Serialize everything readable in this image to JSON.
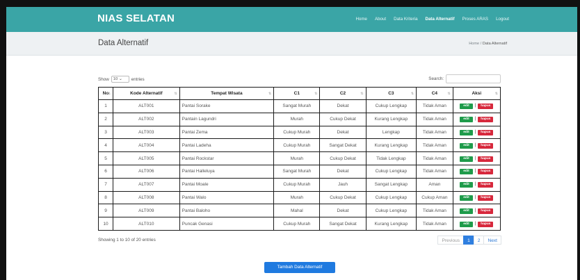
{
  "navbar": {
    "brand": "NIAS SELATAN",
    "links": [
      "Home",
      "About",
      "Data Kriteria",
      "Data Alternatif",
      "Proses ARAS",
      "Logout"
    ],
    "active_index": 3
  },
  "subheader": {
    "title": "Data Alternatif",
    "crumb_home": "Home",
    "crumb_sep": "/",
    "crumb_current": "Data Alternatif"
  },
  "controls": {
    "show_label": "Show",
    "show_value": "10",
    "entries_label": "entries",
    "search_label": "Search:",
    "search_value": ""
  },
  "table": {
    "headers": [
      "No",
      "Kode Alternatif",
      "Tempat Wisata",
      "C1",
      "C2",
      "C3",
      "C4",
      "Aksi"
    ],
    "rows": [
      [
        "1",
        "ALT001",
        "Pantai Sorake",
        "Sangat Murah",
        "Dekat",
        "Cukup Lengkap",
        "Tidak Aman"
      ],
      [
        "2",
        "ALT002",
        "Pantain Lagundri",
        "Murah",
        "Cukup Dekat",
        "Kurang Lengkap",
        "Tidak Aman"
      ],
      [
        "3",
        "ALT003",
        "Pantai Zema",
        "Cukup Murah",
        "Dekat",
        "Lengkap",
        "Tidak Aman"
      ],
      [
        "4",
        "ALT004",
        "Pantai Ladeha",
        "Cukup Murah",
        "Sangat Dekat",
        "Kurang Lengkap",
        "Tidak Aman"
      ],
      [
        "5",
        "ALT005",
        "Pantai Rockstar",
        "Murah",
        "Cukup Dekat",
        "Tidak Lengkap",
        "Tidak Aman"
      ],
      [
        "6",
        "ALT006",
        "Pantai Halleluya",
        "Sangat Murah",
        "Dekat",
        "Cukup Lengkap",
        "Tidak Aman"
      ],
      [
        "7",
        "ALT007",
        "Pantai Moale",
        "Cukup Murah",
        "Jauh",
        "Sangat Lengkap",
        "Aman"
      ],
      [
        "8",
        "ALT008",
        "Pantai Walo",
        "Murah",
        "Cukup Dekat",
        "Cukup Lengkap",
        "Cukup Aman"
      ],
      [
        "9",
        "ALT009",
        "Pantai Baloho",
        "Mahal",
        "Dekat",
        "Cukup Lengkap",
        "Tidak Aman"
      ],
      [
        "10",
        "ALT010",
        "Puncak Genasi",
        "Cukup Murah",
        "Sangat Dekat",
        "Kurang Lengkap",
        "Tidak Aman"
      ]
    ],
    "edit_label": "edit",
    "delete_label": "hapus",
    "action_sep": "|"
  },
  "info_text": "Showing 1 to 10 of 20 entries",
  "pagination": {
    "previous": "Previous",
    "pages": [
      "1",
      "2"
    ],
    "active_page": "1",
    "next": "Next"
  },
  "add_button": "Tambah Data Alternatif",
  "colors": {
    "navbar": "#3aa5a6",
    "edit": "#1e9b4a",
    "delete": "#d7283c",
    "primary": "#1f7ae0"
  }
}
